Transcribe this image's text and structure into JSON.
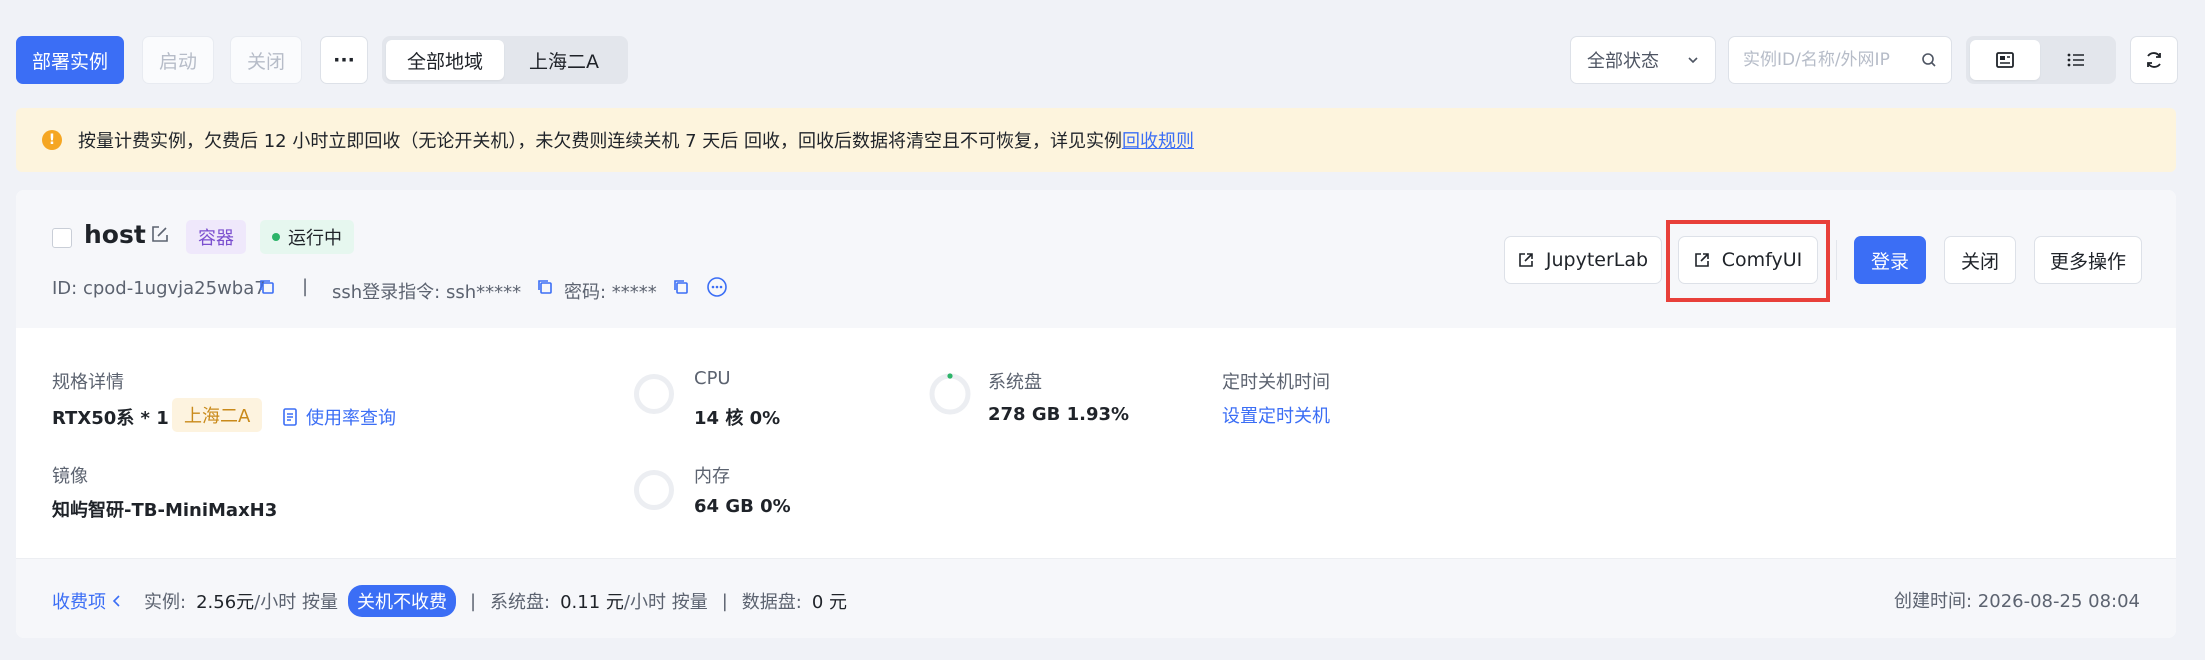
{
  "toolbar": {
    "deploy_label": "部署实例",
    "start_label": "启动",
    "close_label": "关闭",
    "more_label": "···",
    "region_tabs": [
      {
        "label": "全部地域",
        "active": true
      },
      {
        "label": "上海二A",
        "active": false
      }
    ],
    "status_select": "全部状态",
    "search_placeholder": "实例ID/名称/外网IP"
  },
  "notice": {
    "text": "按量计费实例，欠费后 12 小时立即回收（无论开关机），未欠费则连续关机 7 天后 回收，回收后数据将清空且不可恢复，详见实例",
    "link": "回收规则"
  },
  "instance": {
    "name": "host",
    "type_tag": "容器",
    "status": "运行中",
    "id_text": "ID: cpod-1ugvja25wba7",
    "separator": "|",
    "ssh_text": "ssh登录指令: ssh*****",
    "password_text": "密码: *****",
    "buttons": {
      "jupyter": "JupyterLab",
      "comfy": "ComfyUI",
      "login": "登录",
      "close": "关闭",
      "more": "更多操作"
    },
    "spec": {
      "label": "规格详情",
      "value": "RTX50系 * 1",
      "region": "上海二A",
      "usage_link": "使用率查询"
    },
    "image": {
      "label": "镜像",
      "value": "知屿智研-TB-MiniMaxH3"
    },
    "cpu": {
      "label": "CPU",
      "value": "14 核 0%",
      "percent": 0
    },
    "memory": {
      "label": "内存",
      "value": "64 GB 0%",
      "percent": 0
    },
    "disk": {
      "label": "系统盘",
      "value": "278 GB 1.93%",
      "percent": 1.93
    },
    "shutdown": {
      "label": "定时关机时间",
      "link": "设置定时关机"
    },
    "billing": {
      "toggle": "收费项",
      "instance_label": "实例:",
      "instance_price": "2.56元",
      "instance_unit": "/小时 按量",
      "free_badge": "关机不收费",
      "sep": "|",
      "disk_label": "系统盘:",
      "disk_price": "0.11 元",
      "disk_unit": "/小时 按量",
      "data_label": "数据盘:",
      "data_price": "0 元"
    },
    "created": "创建时间: 2026-08-25 08:04"
  },
  "colors": {
    "primary": "#3b6ef5",
    "running": "#2cb469",
    "highlight": "#e8403a",
    "notice_bg": "#fdf4dd"
  }
}
